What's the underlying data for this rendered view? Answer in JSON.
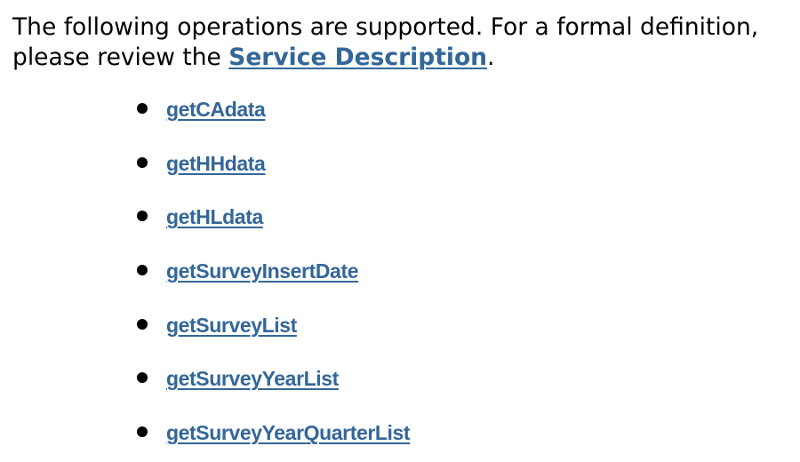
{
  "intro": {
    "text_before": "The following operations are supported. For a formal definition, please review the ",
    "link_label": "Service Description",
    "text_after": "."
  },
  "operations": [
    "getCAdata",
    "getHHdata",
    "getHLdata",
    "getSurveyInsertDate",
    "getSurveyList",
    "getSurveyYearList",
    "getSurveyYearQuarterList"
  ]
}
